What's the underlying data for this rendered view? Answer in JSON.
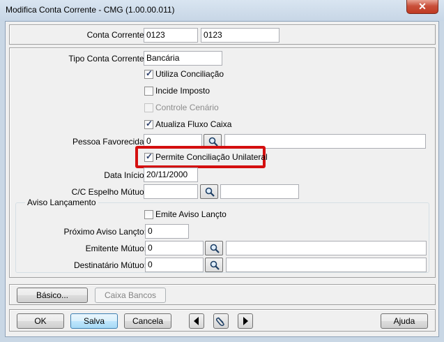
{
  "window": {
    "title": "Modifica Conta Corrente - CMG (1.00.00.011)",
    "close_glyph": "✕"
  },
  "conta": {
    "label": "Conta Corrente:",
    "code": "0123",
    "name": "0123"
  },
  "tipo": {
    "label": "Tipo Conta Corrente:",
    "value": "Bancária"
  },
  "checks": {
    "utiliza": {
      "label": "Utiliza Conciliação",
      "checked": true
    },
    "incide": {
      "label": "Incide Imposto",
      "checked": false
    },
    "controle": {
      "label": "Controle Cenário",
      "checked": false,
      "disabled": true
    },
    "atualiza": {
      "label": "Atualiza Fluxo Caixa",
      "checked": true
    },
    "permite": {
      "label": "Permite Conciliação Unilateral",
      "checked": true
    }
  },
  "pessoa": {
    "label": "Pessoa Favorecida:",
    "value": "0",
    "description": ""
  },
  "data_inicio": {
    "label": "Data Início:",
    "value": "20/11/2000"
  },
  "espelho": {
    "label": "C/C Espelho Mútuo:",
    "value": "",
    "description": ""
  },
  "aviso": {
    "group_title": "Aviso Lançamento",
    "emite": {
      "label": "Emite Aviso Lançto",
      "checked": false
    },
    "proximo": {
      "label": "Próximo Aviso Lançto:",
      "value": "0"
    },
    "emitente": {
      "label": "Emitente Mútuo:",
      "value": "0",
      "description": ""
    },
    "destinatario": {
      "label": "Destinatário Mútuo:",
      "value": "0",
      "description": ""
    }
  },
  "tabs": {
    "basico": "Básico...",
    "caixa_bancos": "Caixa Bancos"
  },
  "actions": {
    "ok": "OK",
    "salva": "Salva",
    "cancela": "Cancela",
    "ajuda": "Ajuda"
  },
  "colors": {
    "highlight": "#d40f0f",
    "title_bg": "#c9d7e5"
  }
}
